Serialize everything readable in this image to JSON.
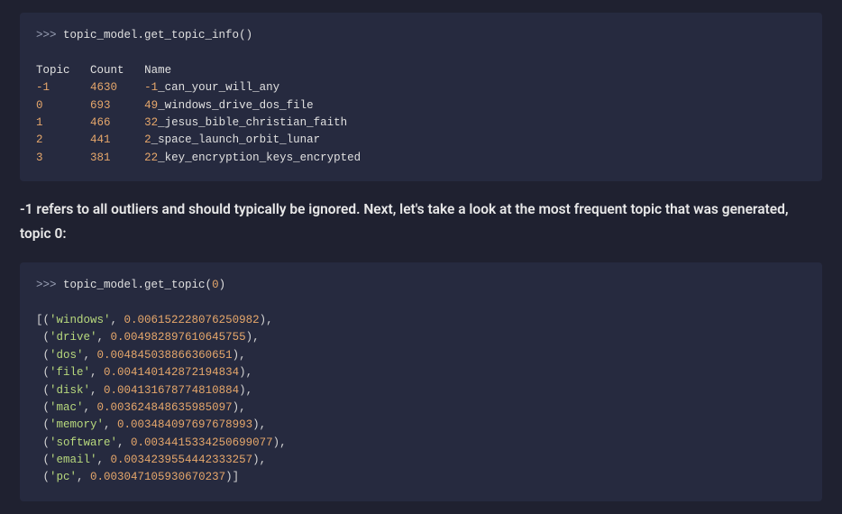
{
  "code1": {
    "prompt": ">>>",
    "call": "topic_model.get_topic_info()",
    "headers": {
      "topic": "Topic",
      "count": "Count",
      "name": "Name"
    },
    "rows": [
      {
        "topic": "-1",
        "count": "4630",
        "prefix": "-1",
        "rest": "_can_your_will_any"
      },
      {
        "topic": "0",
        "count": "693",
        "prefix": "49",
        "rest": "_windows_drive_dos_file"
      },
      {
        "topic": "1",
        "count": "466",
        "prefix": "32",
        "rest": "_jesus_bible_christian_faith"
      },
      {
        "topic": "2",
        "count": "441",
        "prefix": "2",
        "rest": "_space_launch_orbit_lunar"
      },
      {
        "topic": "3",
        "count": "381",
        "prefix": "22",
        "rest": "_key_encryption_keys_encrypted"
      }
    ]
  },
  "paragraph": "-1 refers to all outliers and should typically be ignored. Next, let's take a look at the most frequent topic that was generated, topic 0:",
  "code2": {
    "prompt": ">>>",
    "call_pre": "topic_model.get_topic(",
    "arg": "0",
    "call_post": ")",
    "tuples": [
      {
        "word": "'windows'",
        "val": "0.006152228076250982"
      },
      {
        "word": "'drive'",
        "val": "0.004982897610645755"
      },
      {
        "word": "'dos'",
        "val": "0.004845038866360651"
      },
      {
        "word": "'file'",
        "val": "0.004140142872194834"
      },
      {
        "word": "'disk'",
        "val": "0.004131678774810884"
      },
      {
        "word": "'mac'",
        "val": "0.003624848635985097"
      },
      {
        "word": "'memory'",
        "val": "0.003484097697678993"
      },
      {
        "word": "'software'",
        "val": "0.0034415334250699077"
      },
      {
        "word": "'email'",
        "val": "0.0034239554442333257"
      },
      {
        "word": "'pc'",
        "val": "0.003047105930670237"
      }
    ]
  }
}
